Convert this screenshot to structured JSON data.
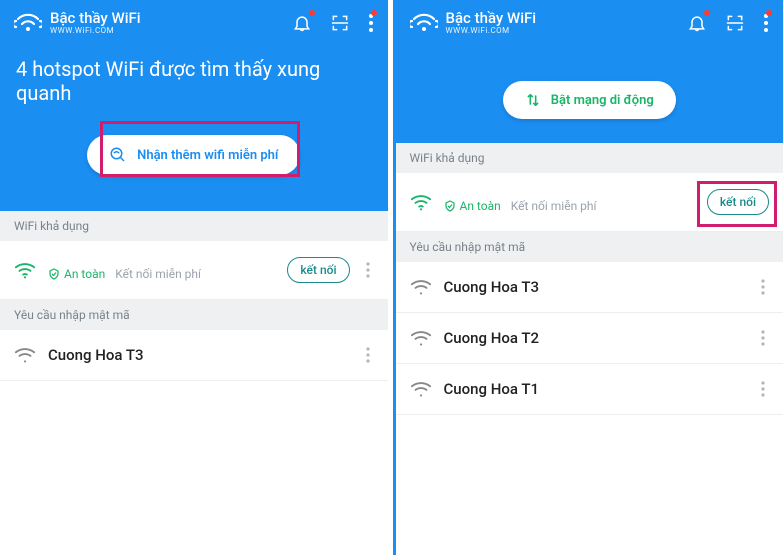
{
  "app": {
    "name": "Bậc thầy WiFi",
    "url": "WWW.WiFi.COM"
  },
  "left": {
    "headline": "4 hotspot WiFi được tìm thấy xung quanh",
    "cta_label": "Nhận thêm wifi miễn phí",
    "sections": {
      "available": "WiFi khả dụng",
      "needpw": "Yêu cầu nhập mật mã"
    },
    "first_net": {
      "safe": "An toàn",
      "free": "Kết nối miễn phí",
      "connect": "kết nối"
    },
    "pw_nets": [
      {
        "name": "Cuong Hoa T3"
      }
    ]
  },
  "right": {
    "cta_label": "Bật mạng di động",
    "sections": {
      "available": "WiFi khả dụng",
      "needpw": "Yêu cầu nhập mật mã"
    },
    "first_net": {
      "safe": "An toàn",
      "free": "Kết nối miễn phí",
      "connect": "kết nối"
    },
    "pw_nets": [
      {
        "name": "Cuong Hoa T3"
      },
      {
        "name": "Cuong Hoa T2"
      },
      {
        "name": "Cuong Hoa T1"
      }
    ]
  }
}
